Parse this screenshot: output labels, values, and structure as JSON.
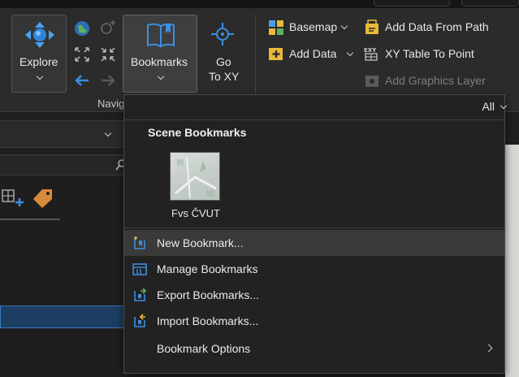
{
  "ribbon": {
    "explore_label": "Explore",
    "bookmarks_label": "Bookmarks",
    "goto_line1": "Go",
    "goto_line2": "To XY",
    "basemap_label": "Basemap",
    "add_data_label": "Add Data",
    "add_data_from_path_label": "Add Data From Path",
    "xy_table_to_point_label": "XY Table To Point",
    "add_graphics_layer_label": "Add Graphics Layer",
    "group_label_partial": "Navig"
  },
  "dropdown": {
    "filter_label": "All",
    "section_heading": "Scene Bookmarks",
    "bookmarks": [
      {
        "name": "Fvs ČVUT"
      }
    ],
    "menu_items": [
      {
        "label": "New Bookmark...",
        "icon": "new-bookmark-icon",
        "highlighted": true
      },
      {
        "label": "Manage Bookmarks",
        "icon": "manage-bookmarks-icon"
      },
      {
        "label": "Export Bookmarks...",
        "icon": "export-bookmarks-icon"
      },
      {
        "label": "Import Bookmarks...",
        "icon": "import-bookmarks-icon"
      },
      {
        "label": "Bookmark Options",
        "icon": "",
        "has_submenu": true
      }
    ]
  },
  "colors": {
    "accent_blue": "#3b8fe0",
    "highlight_row": "#3a3a3a",
    "selection_blue": "#1c3e62"
  }
}
